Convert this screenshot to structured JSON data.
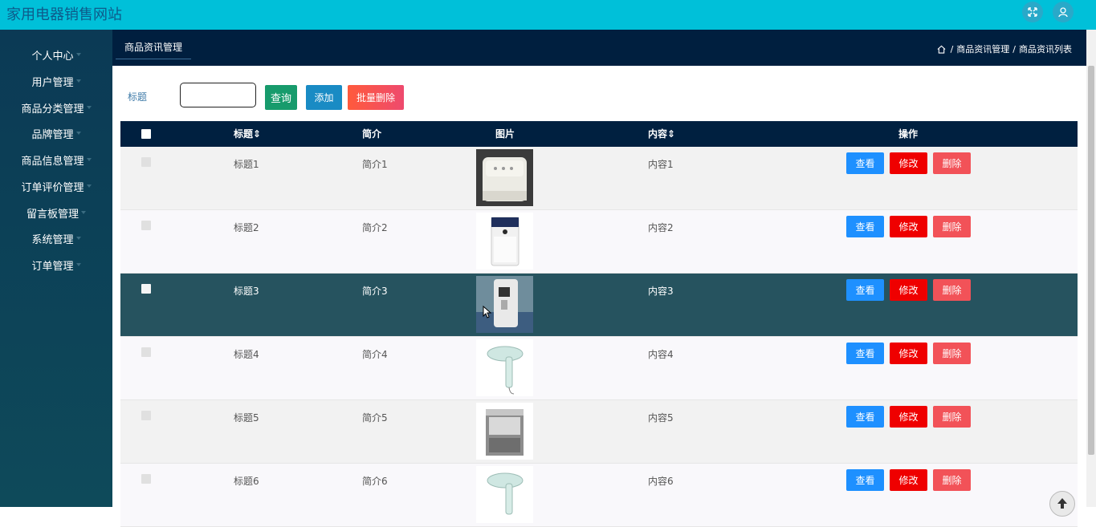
{
  "app": {
    "title": "家用电器销售网站"
  },
  "sidebar": {
    "items": [
      {
        "label": "个人中心",
        "has_caret": true
      },
      {
        "label": "用户管理",
        "has_caret": true
      },
      {
        "label": "商品分类管理",
        "has_caret": true
      },
      {
        "label": "品牌管理",
        "has_caret": true
      },
      {
        "label": "商品信息管理",
        "has_caret": true
      },
      {
        "label": "订单评价管理",
        "has_caret": true
      },
      {
        "label": "留言板管理",
        "has_caret": true
      },
      {
        "label": "系统管理",
        "has_caret": true
      },
      {
        "label": "订单管理",
        "has_caret": true
      }
    ]
  },
  "header": {
    "active_tab": "商品资讯管理",
    "breadcrumb": [
      "商品资讯管理",
      "商品资讯列表"
    ],
    "breadcrumb_sep": "/"
  },
  "search": {
    "label": "标题",
    "value": "",
    "query_label": "查询",
    "add_label": "添加",
    "batch_delete_label": "批量删除"
  },
  "table": {
    "columns": [
      "标题",
      "简介",
      "图片",
      "内容",
      "操作"
    ],
    "sortable_marker": "⇕",
    "rows": [
      {
        "title": "标题1",
        "intro": "简介1",
        "image": "rice-cooker",
        "content": "内容1"
      },
      {
        "title": "标题2",
        "intro": "简介2",
        "image": "air-purifier",
        "content": "内容2"
      },
      {
        "title": "标题3",
        "intro": "简介3",
        "image": "water-dispenser",
        "content": "内容3"
      },
      {
        "title": "标题4",
        "intro": "简介4",
        "image": "hair-dryer",
        "content": "内容4"
      },
      {
        "title": "标题5",
        "intro": "简介5",
        "image": "dishwasher",
        "content": "内容5"
      },
      {
        "title": "标题6",
        "intro": "简介6",
        "image": "hair-dryer",
        "content": "内容6"
      }
    ],
    "actions": {
      "view": "查看",
      "edit": "修改",
      "delete": "删除"
    }
  },
  "colors": {
    "topbar": "#00c0d9",
    "sidebar": "#0b3a55",
    "header": "#001f3f",
    "hover_row": "#26535f",
    "view": "#1e90ff",
    "edit": "#ef0000",
    "delete": "#f25258"
  }
}
